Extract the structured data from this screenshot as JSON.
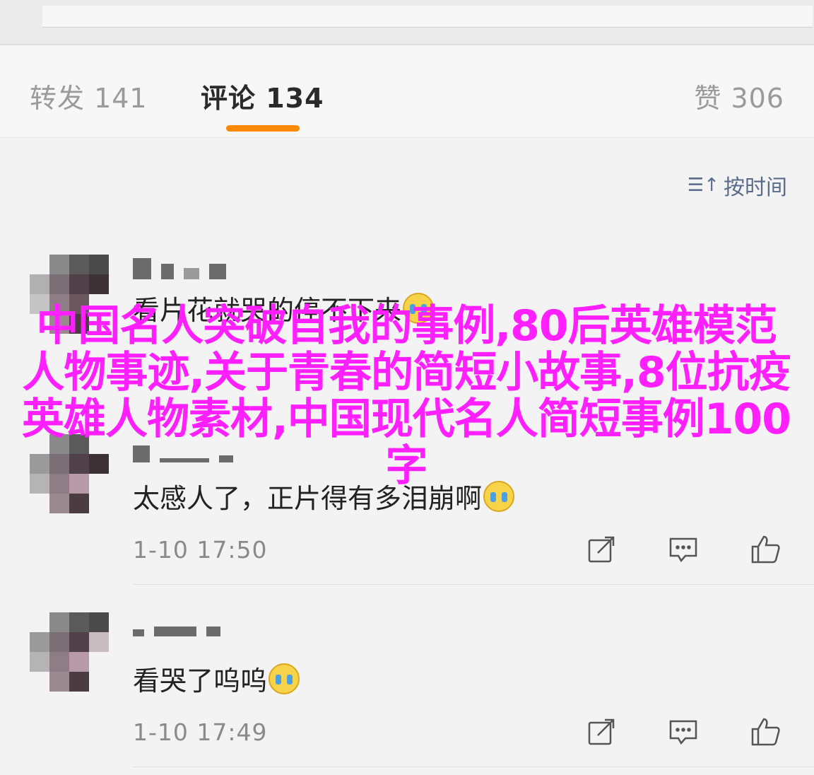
{
  "tabs": {
    "repost": "转发 141",
    "comment": "评论 134",
    "like": "赞 306"
  },
  "sort": {
    "icon": "sort-icon",
    "label": "按时间"
  },
  "comments": [
    {
      "text": "看片花就哭的停不下来",
      "emoji": "crying-face",
      "time": ""
    },
    {
      "text": "太感人了，正片得有多泪崩啊",
      "emoji": "crying-face",
      "time": "1-10 17:50"
    },
    {
      "text": "看哭了呜呜",
      "emoji": "crying-face",
      "time": "1-10 17:49"
    }
  ],
  "actions": {
    "share_icon": "share-icon",
    "reply_icon": "comment-icon",
    "like_icon": "thumbs-up-icon"
  },
  "overlay": {
    "title": "中国名人突破自我的事例,80后英雄模范人物事迹,关于青春的简短小故事,8位抗疫英雄人物素材,中国现代名人简短事例100字"
  },
  "colors": {
    "accent": "#ff8a00",
    "overlay": "#ff1fff",
    "sort": "#5a6b8a"
  }
}
